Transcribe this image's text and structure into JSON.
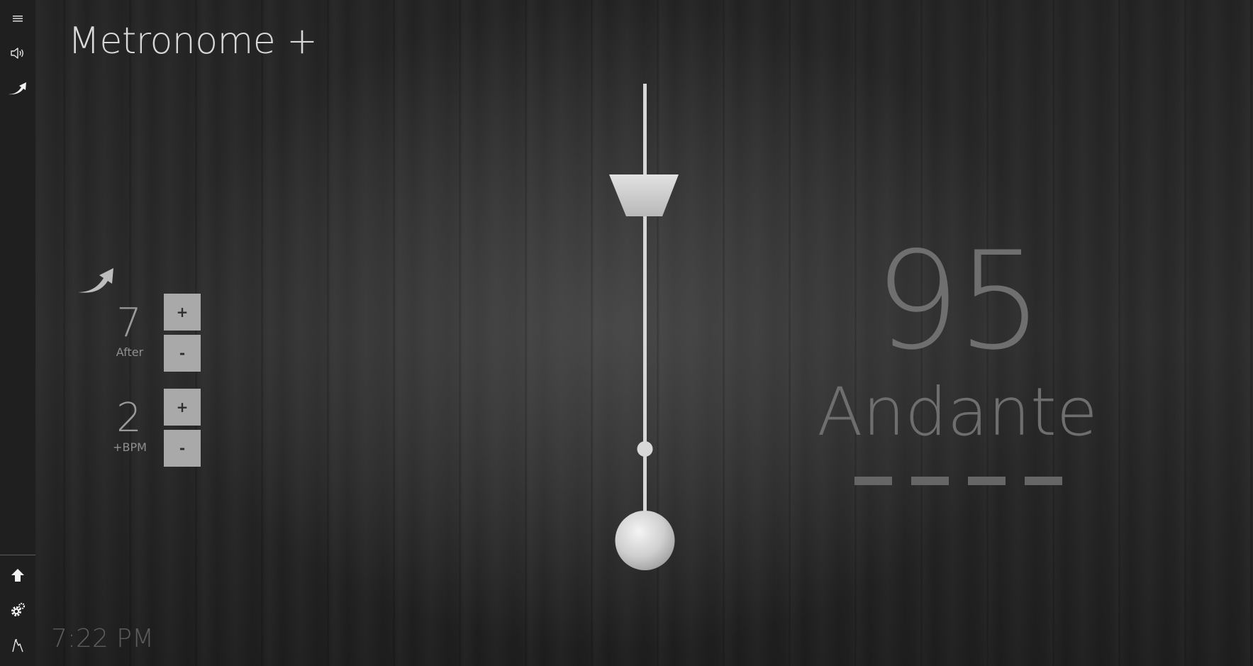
{
  "app": {
    "title": "Metronome +"
  },
  "sidebar": {
    "top_icons": [
      "menu-icon",
      "speaker-icon",
      "tempo-ramp-icon"
    ],
    "bottom_icons": [
      "home-arrow-icon",
      "gear-icon",
      "tap-icon"
    ]
  },
  "speed_trainer": {
    "icon": "tempo-ramp-icon",
    "after": {
      "value": "7",
      "caption": "After",
      "plus_label": "+",
      "minus_label": "-"
    },
    "bpm_step": {
      "value": "2",
      "caption": "+BPM",
      "plus_label": "+",
      "minus_label": "-"
    }
  },
  "tempo": {
    "bpm": "95",
    "marking": "Andante",
    "beats": 4
  },
  "status": {
    "clock": "7:22 PM"
  },
  "colors": {
    "sidebar": "#1f1f1f",
    "button": "#a9a9a9",
    "pendulum": "#d8d8d8",
    "readout": "#6f6f6f"
  }
}
